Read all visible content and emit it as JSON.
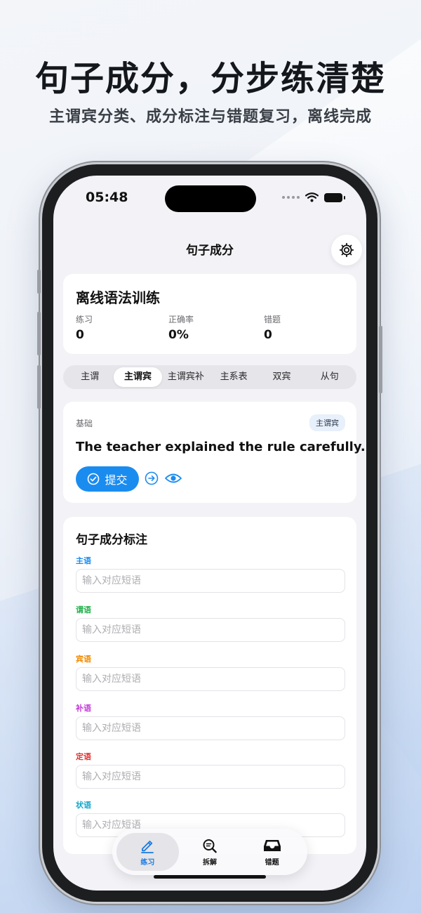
{
  "headline": "句子成分，分步练清楚",
  "subhead": "主谓宾分类、成分标注与错题复习，离线完成",
  "status": {
    "time": "05:48"
  },
  "nav": {
    "title": "句子成分"
  },
  "stats": {
    "title": "离线语法训练",
    "items": [
      {
        "label": "练习",
        "value": "0"
      },
      {
        "label": "正确率",
        "value": "0%"
      },
      {
        "label": "错题",
        "value": "0"
      }
    ]
  },
  "segments": {
    "items": [
      "主谓",
      "主谓宾",
      "主谓宾补",
      "主系表",
      "双宾",
      "从句"
    ],
    "selected": "主谓宾"
  },
  "question": {
    "level": "基础",
    "tag": "主谓宾",
    "sentence": "The teacher explained the rule carefully.",
    "submit_label": "提交"
  },
  "form": {
    "title": "句子成分标注",
    "fields": [
      {
        "label": "主语",
        "placeholder": "输入对应短语",
        "color": "#1a8cf0"
      },
      {
        "label": "谓语",
        "placeholder": "输入对应短语",
        "color": "#22b04b"
      },
      {
        "label": "宾语",
        "placeholder": "输入对应短语",
        "color": "#f08a00"
      },
      {
        "label": "补语",
        "placeholder": "输入对应短语",
        "color": "#c23ad6"
      },
      {
        "label": "定语",
        "placeholder": "输入对应短语",
        "color": "#e03131"
      },
      {
        "label": "状语",
        "placeholder": "输入对应短语",
        "color": "#12a6c9"
      }
    ]
  },
  "tabbar": {
    "items": [
      {
        "label": "练习",
        "icon": "pencil-icon"
      },
      {
        "label": "拆解",
        "icon": "magnifier-icon"
      },
      {
        "label": "错题",
        "icon": "tray-icon"
      }
    ],
    "selected": "练习"
  },
  "colors": {
    "accent": "#1a8cf0",
    "background": "#f2f2f7"
  }
}
